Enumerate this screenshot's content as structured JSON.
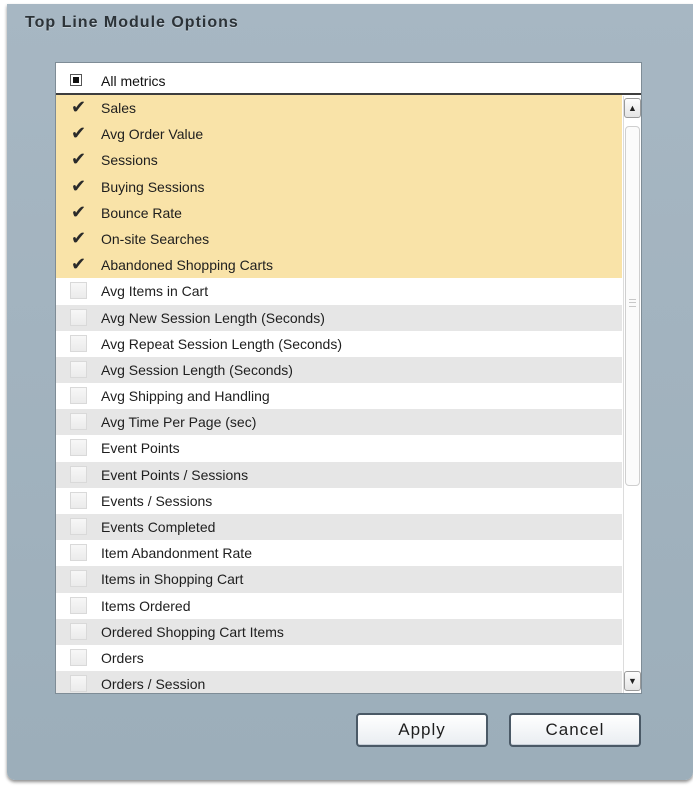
{
  "dialog": {
    "title": "Top Line Module Options"
  },
  "all_metrics": {
    "label": "All metrics",
    "state": "partial"
  },
  "metrics": [
    {
      "label": "Sales",
      "checked": true
    },
    {
      "label": "Avg Order Value",
      "checked": true
    },
    {
      "label": "Sessions",
      "checked": true
    },
    {
      "label": "Buying Sessions",
      "checked": true
    },
    {
      "label": "Bounce Rate",
      "checked": true
    },
    {
      "label": "On-site Searches",
      "checked": true
    },
    {
      "label": "Abandoned Shopping Carts",
      "checked": true
    },
    {
      "label": "Avg Items in Cart",
      "checked": false
    },
    {
      "label": "Avg New Session Length (Seconds)",
      "checked": false
    },
    {
      "label": "Avg Repeat Session Length (Seconds)",
      "checked": false
    },
    {
      "label": "Avg Session Length (Seconds)",
      "checked": false
    },
    {
      "label": "Avg Shipping and Handling",
      "checked": false
    },
    {
      "label": "Avg Time Per Page (sec)",
      "checked": false
    },
    {
      "label": "Event Points",
      "checked": false
    },
    {
      "label": "Event Points / Sessions",
      "checked": false
    },
    {
      "label": "Events / Sessions",
      "checked": false
    },
    {
      "label": "Events Completed",
      "checked": false
    },
    {
      "label": "Item Abandonment Rate",
      "checked": false
    },
    {
      "label": "Items in Shopping Cart",
      "checked": false
    },
    {
      "label": "Items Ordered",
      "checked": false
    },
    {
      "label": "Ordered Shopping Cart Items",
      "checked": false
    },
    {
      "label": "Orders",
      "checked": false
    },
    {
      "label": "Orders / Session",
      "checked": false
    }
  ],
  "scrollbar": {
    "up_icon": "triangle-up-icon",
    "down_icon": "triangle-down-icon"
  },
  "buttons": {
    "apply_label": "Apply",
    "cancel_label": "Cancel"
  },
  "colors": {
    "selected_row": "#f9e3a8",
    "alt_row": "#e6e6e6",
    "dialog_bg": "#a3b4c0"
  }
}
